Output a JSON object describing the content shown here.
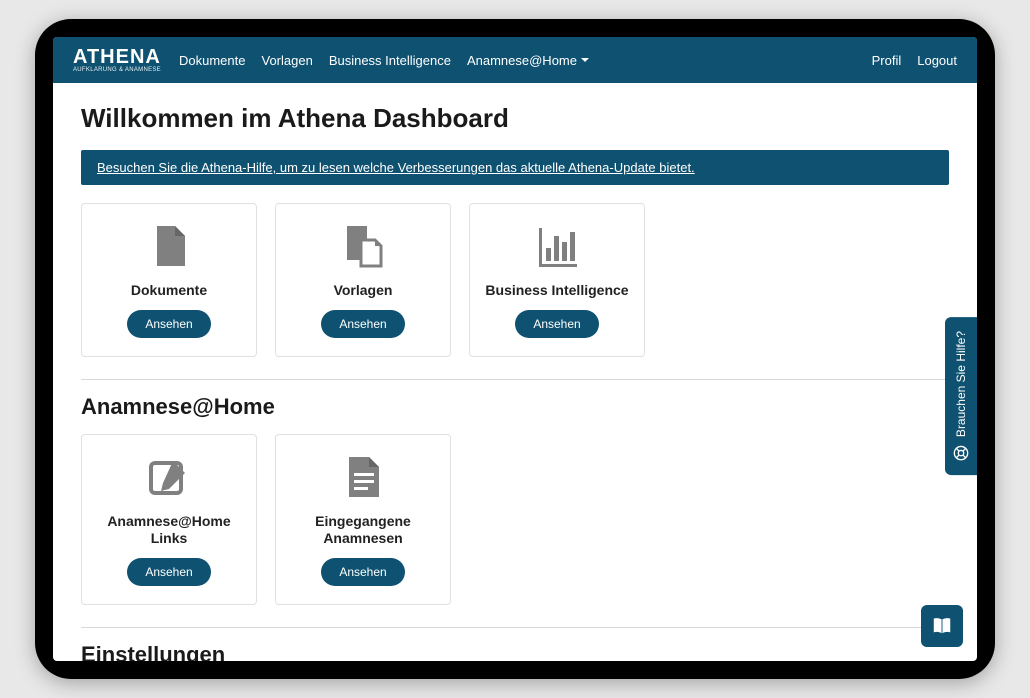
{
  "brand": {
    "title": "ATHENA",
    "subtitle": "AUFKLÄRUNG & ANAMNESE"
  },
  "nav": {
    "links": [
      "Dokumente",
      "Vorlagen",
      "Business Intelligence",
      "Anamnese@Home"
    ],
    "right": [
      "Profil",
      "Logout"
    ]
  },
  "page_title": "Willkommen im Athena Dashboard",
  "banner": "Besuchen Sie die Athena-Hilfe, um zu lesen welche Verbesserungen das aktuelle Athena-Update bietet.",
  "cards_main": [
    {
      "title": "Dokumente",
      "button": "Ansehen"
    },
    {
      "title": "Vorlagen",
      "button": "Ansehen"
    },
    {
      "title": "Business Intelligence",
      "button": "Ansehen"
    }
  ],
  "section_anamnese": {
    "title": "Anamnese@Home",
    "cards": [
      {
        "title": "Anamnese@Home Links",
        "button": "Ansehen"
      },
      {
        "title": "Eingegangene Anamnesen",
        "button": "Ansehen"
      }
    ]
  },
  "section_settings_title": "Einstellungen",
  "help_tab": "Brauchen Sie Hilfe?",
  "colors": {
    "primary": "#0e5170",
    "icon_gray": "#808080"
  }
}
